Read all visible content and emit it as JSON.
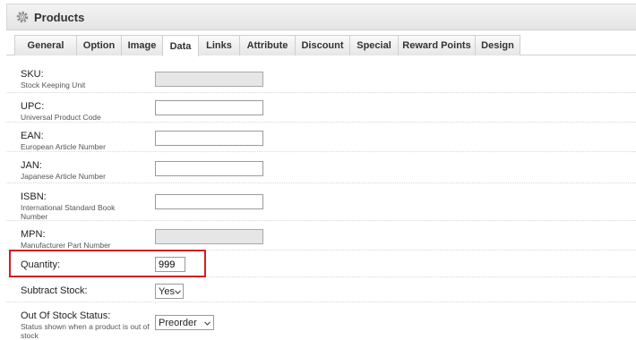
{
  "header": {
    "title": "Products",
    "icon": "gear-icon"
  },
  "tabs": [
    {
      "label": "General"
    },
    {
      "label": "Option"
    },
    {
      "label": "Image"
    },
    {
      "label": "Data",
      "active": true
    },
    {
      "label": "Links"
    },
    {
      "label": "Attribute"
    },
    {
      "label": "Discount"
    },
    {
      "label": "Special"
    },
    {
      "label": "Reward Points"
    },
    {
      "label": "Design"
    }
  ],
  "fields": {
    "sku": {
      "label": "SKU:",
      "help": "Stock Keeping Unit",
      "value": ""
    },
    "upc": {
      "label": "UPC:",
      "help": "Universal Product Code",
      "value": ""
    },
    "ean": {
      "label": "EAN:",
      "help": "European Article Number",
      "value": ""
    },
    "jan": {
      "label": "JAN:",
      "help": "Japanese Article Number",
      "value": ""
    },
    "isbn": {
      "label": "ISBN:",
      "help": "International Standard Book Number",
      "value": ""
    },
    "mpn": {
      "label": "MPN:",
      "help": "Manufacturer Part Number",
      "value": ""
    },
    "quantity": {
      "label": "Quantity:",
      "value": "999"
    },
    "subtract_stock": {
      "label": "Subtract Stock:",
      "value": "Yes"
    },
    "out_of_stock_status": {
      "label": "Out Of Stock Status:",
      "help": "Status shown when a product is out of stock",
      "value": "Preorder"
    }
  },
  "colors": {
    "highlight": "#d02020",
    "header_bg": "#e9e9e9"
  }
}
